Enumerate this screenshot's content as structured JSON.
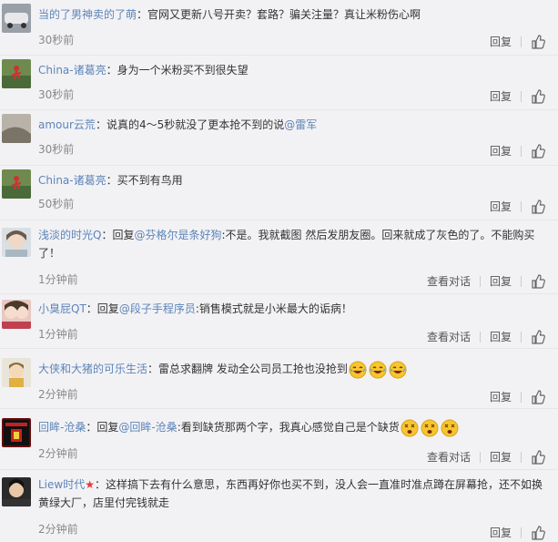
{
  "comments": [
    {
      "name": "当的了男神卖的了萌",
      "sep": "：",
      "text": "官网又更新八号开卖？套路？骗关注量？真让米粉伤心啊",
      "time": "30秒前",
      "reply": "回复"
    },
    {
      "name": "China-诸葛亮",
      "sep": "：",
      "text": "身为一个米粉买不到很失望",
      "time": "30秒前",
      "reply": "回复"
    },
    {
      "name": "amour云荒",
      "sep": "：",
      "text": "说真的4～5秒就没了更本抢不到的说",
      "mention": "@雷军",
      "time": "30秒前",
      "reply": "回复"
    },
    {
      "name": "China-诸葛亮",
      "sep": "：",
      "text": "买不到有鸟用",
      "time": "50秒前",
      "reply": "回复"
    },
    {
      "name": "浅淡的时光Q",
      "sep": "：",
      "pre": "回复",
      "mention": "@芬格尔是条好狗",
      "text": ":不是。我就截图 然后发朋友圈。回来就成了灰色的了。不能购买了！",
      "time": "1分钟前",
      "view": "查看对话",
      "reply": "回复"
    },
    {
      "name": "小臭屁QT",
      "sep": "：",
      "pre": "回复",
      "mention": "@段子手程序员",
      "text": ":销售模式就是小米最大的诟病！",
      "time": "1分钟前",
      "view": "查看对话",
      "reply": "回复"
    },
    {
      "name": "大侠和大猪的可乐生活",
      "sep": "：",
      "text": "雷总求翻牌 发动全公司员工抢也没抢到",
      "time": "2分钟前",
      "reply": "回复"
    },
    {
      "name": "回眸-沧桑",
      "sep": "：",
      "pre": "回复",
      "mention": "@回眸-沧桑",
      "text": ":看到缺货那两个字，我真心感觉自己是个缺货",
      "time": "2分钟前",
      "view": "查看对话",
      "reply": "回复"
    },
    {
      "name": "Liew时代",
      "badge": "★",
      "sep": "：",
      "text": "这样搞下去有什么意思，东西再好你也买不到，没人会一直准时准点蹲在屏幕抢，还不如换黄绿大厂，店里付完钱就走",
      "time": "2分钟前",
      "reply": "回复"
    }
  ],
  "colors": {
    "link": "#5d84b8",
    "time": "#888888",
    "background": "#f2f2f5"
  }
}
